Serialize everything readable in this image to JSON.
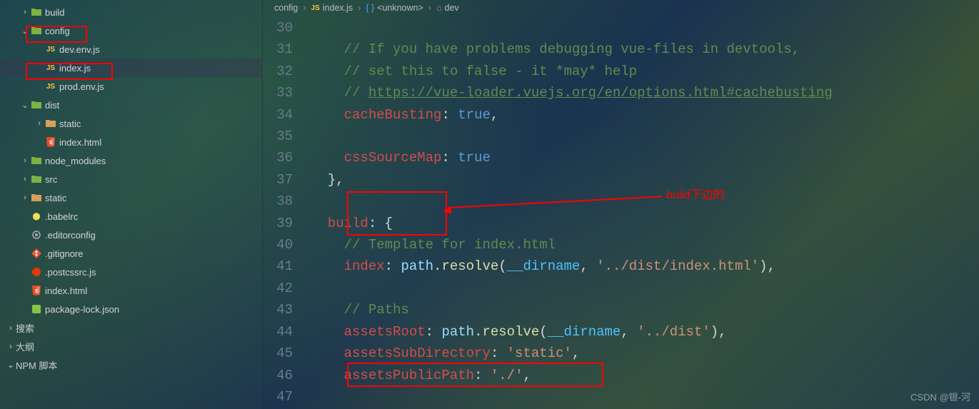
{
  "sidebar": {
    "items": [
      {
        "label": "build",
        "icon": "folder",
        "indent": 1,
        "chevron": "right",
        "folderColor": "green"
      },
      {
        "label": "config",
        "icon": "folder",
        "indent": 1,
        "chevron": "down",
        "folderColor": "green"
      },
      {
        "label": "dev.env.js",
        "icon": "js",
        "indent": 2,
        "chevron": ""
      },
      {
        "label": "index.js",
        "icon": "js",
        "indent": 2,
        "chevron": "",
        "active": true
      },
      {
        "label": "prod.env.js",
        "icon": "js",
        "indent": 2,
        "chevron": ""
      },
      {
        "label": "dist",
        "icon": "folder",
        "indent": 1,
        "chevron": "down",
        "folderColor": "green"
      },
      {
        "label": "static",
        "icon": "folder",
        "indent": 2,
        "chevron": "right"
      },
      {
        "label": "index.html",
        "icon": "html",
        "indent": 2,
        "chevron": ""
      },
      {
        "label": "node_modules",
        "icon": "folder",
        "indent": 1,
        "chevron": "right",
        "folderColor": "green"
      },
      {
        "label": "src",
        "icon": "folder",
        "indent": 1,
        "chevron": "right",
        "folderColor": "green"
      },
      {
        "label": "static",
        "icon": "folder",
        "indent": 1,
        "chevron": "right"
      },
      {
        "label": ".babelrc",
        "icon": "babel",
        "indent": 1,
        "chevron": ""
      },
      {
        "label": ".editorconfig",
        "icon": "config",
        "indent": 1,
        "chevron": ""
      },
      {
        "label": ".gitignore",
        "icon": "git",
        "indent": 1,
        "chevron": ""
      },
      {
        "label": ".postcssrc.js",
        "icon": "postcss",
        "indent": 1,
        "chevron": ""
      },
      {
        "label": "index.html",
        "icon": "html",
        "indent": 1,
        "chevron": ""
      },
      {
        "label": "package-lock.json",
        "icon": "json",
        "indent": 1,
        "chevron": ""
      }
    ],
    "panels": [
      {
        "label": "搜索",
        "chevron": "right"
      },
      {
        "label": "大纲",
        "chevron": "right"
      },
      {
        "label": "NPM 脚本",
        "chevron": "down"
      }
    ]
  },
  "breadcrumb": {
    "parts": [
      "config",
      "index.js",
      "<unknown>",
      "dev"
    ]
  },
  "code": {
    "startLine": 30,
    "lines": [
      {
        "n": 30,
        "html": ""
      },
      {
        "n": 31,
        "html": "    <span class='c-comment'>// If you have problems debugging vue-files in devtools,</span>"
      },
      {
        "n": 32,
        "html": "    <span class='c-comment'>// set this to false - it *may* help</span>"
      },
      {
        "n": 33,
        "html": "    <span class='c-comment'>// </span><span class='c-url'>https://vue-loader.vuejs.org/en/options.html#cachebusting</span>"
      },
      {
        "n": 34,
        "html": "    <span class='c-prop'>cacheBusting</span><span class='c-punct'>: </span><span class='c-true'>true</span><span class='c-punct'>,</span>"
      },
      {
        "n": 35,
        "html": ""
      },
      {
        "n": 36,
        "html": "    <span class='c-prop'>cssSourceMap</span><span class='c-punct'>: </span><span class='c-true'>true</span>"
      },
      {
        "n": 37,
        "html": "  <span class='c-punct'>},</span>"
      },
      {
        "n": 38,
        "html": ""
      },
      {
        "n": 39,
        "html": "  <span class='c-prop'>build</span><span class='c-punct'>: {</span>"
      },
      {
        "n": 40,
        "html": "    <span class='c-comment'>// Template for index.html</span>"
      },
      {
        "n": 41,
        "html": "    <span class='c-prop'>index</span><span class='c-punct'>: </span><span class='c-obj'>path</span><span class='c-punct'>.</span><span class='c-func'>resolve</span><span class='c-punct'>(</span><span class='c-dirname'>__dirname</span><span class='c-punct'>, </span><span class='c-string'>'../dist/index.html'</span><span class='c-punct'>),</span>"
      },
      {
        "n": 42,
        "html": ""
      },
      {
        "n": 43,
        "html": "    <span class='c-comment'>// Paths</span>"
      },
      {
        "n": 44,
        "html": "    <span class='c-prop'>assetsRoot</span><span class='c-punct'>: </span><span class='c-obj'>path</span><span class='c-punct'>.</span><span class='c-func'>resolve</span><span class='c-punct'>(</span><span class='c-dirname'>__dirname</span><span class='c-punct'>, </span><span class='c-string'>'../dist'</span><span class='c-punct'>),</span>"
      },
      {
        "n": 45,
        "html": "    <span class='c-prop'>assetsSubDirectory</span><span class='c-punct'>: </span><span class='c-string'>'static'</span><span class='c-punct'>,</span>"
      },
      {
        "n": 46,
        "html": "    <span class='c-prop'>assetsPublicPath</span><span class='c-punct'>: </span><span class='c-string'>'./'</span><span class='c-punct'>,</span>"
      },
      {
        "n": 47,
        "html": ""
      }
    ]
  },
  "annotations": {
    "text": "build下边的"
  },
  "watermark": "CSDN @银-河"
}
